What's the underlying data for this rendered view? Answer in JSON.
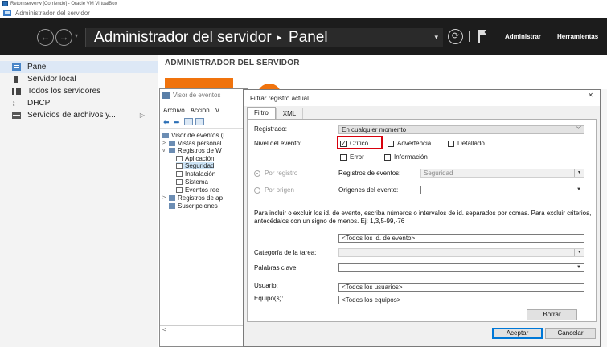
{
  "vbox": {
    "title": "Retomserverw [Corriendo] - Oracle VM VirtualBox"
  },
  "window": {
    "title": "Administrador del servidor"
  },
  "cmdbar": {
    "breadcrumb_app": "Administrador del servidor",
    "breadcrumb_separator": "▸",
    "breadcrumb_page": "Panel",
    "menu_admin": "Administrar",
    "menu_tools": "Herramientas"
  },
  "sidebar": {
    "items": [
      {
        "label": "Panel",
        "icon": "dashboard-icon",
        "active": true
      },
      {
        "label": "Servidor local",
        "icon": "server-icon"
      },
      {
        "label": "Todos los servidores",
        "icon": "servers-icon"
      },
      {
        "label": "DHCP",
        "icon": "dhcp-icon"
      },
      {
        "label": "Servicios de archivos y...",
        "icon": "file-services-icon",
        "expand": "▷"
      }
    ]
  },
  "main": {
    "header": "ADMINISTRADOR DEL SERVIDOR"
  },
  "event_viewer": {
    "title": "Visor de eventos",
    "menu": [
      "Archivo",
      "Acción",
      "V"
    ],
    "tree": [
      {
        "label": "Visor de eventos (l",
        "level": 0,
        "arrow": ""
      },
      {
        "label": "Vistas personal",
        "level": 1,
        "arrow": ">"
      },
      {
        "label": "Registros de W",
        "level": 1,
        "arrow": "v"
      },
      {
        "label": "Aplicación",
        "level": 2,
        "arrow": ""
      },
      {
        "label": "Seguridad",
        "level": 2,
        "arrow": "",
        "selected": true
      },
      {
        "label": "Instalación",
        "level": 2,
        "arrow": ""
      },
      {
        "label": "Sistema",
        "level": 2,
        "arrow": ""
      },
      {
        "label": "Eventos ree",
        "level": 2,
        "arrow": ""
      },
      {
        "label": "Registros de ap",
        "level": 1,
        "arrow": ">"
      },
      {
        "label": "Suscripciones",
        "level": 1,
        "arrow": ""
      }
    ],
    "scroll_left": "<"
  },
  "dialog": {
    "title": "Filtrar registro actual",
    "close": "✕",
    "tabs": [
      "Filtro",
      "XML"
    ],
    "logged_label": "Registrado:",
    "logged_value": "En cualquier momento",
    "level_label": "Nivel del evento:",
    "levels": [
      {
        "label": "Crítico",
        "checked": true
      },
      {
        "label": "Advertencia",
        "checked": false
      },
      {
        "label": "Detallado",
        "checked": false
      },
      {
        "label": "Error",
        "checked": false
      },
      {
        "label": "Información",
        "checked": false
      }
    ],
    "by_log": "Por registro",
    "by_source": "Por origen",
    "event_logs_label": "Registros de eventos:",
    "event_logs_value": "Seguridad",
    "sources_label": "Orígenes del evento:",
    "sources_value": "",
    "help_text": "Para incluir o excluir los id. de evento, escriba números o intervalos de id. separados por comas. Para excluir criterios, antecédalos con un signo de menos. Ej: 1,3,5-99,-76",
    "event_ids_value": "<Todos los id. de evento>",
    "task_category_label": "Categoría de la tarea:",
    "keywords_label": "Palabras clave:",
    "user_label": "Usuario:",
    "user_value": "<Todos los usuarios>",
    "computer_label": "Equipo(s):",
    "computer_value": "<Todos los equipos>",
    "clear_button": "Borrar",
    "ok_button": "Aceptar",
    "cancel_button": "Cancelar"
  },
  "colors": {
    "accent_orange": "#f0730d",
    "highlight_red": "#d8000c",
    "cmdbar_bg": "#1c1c1c",
    "active_blue": "#0078d7"
  }
}
